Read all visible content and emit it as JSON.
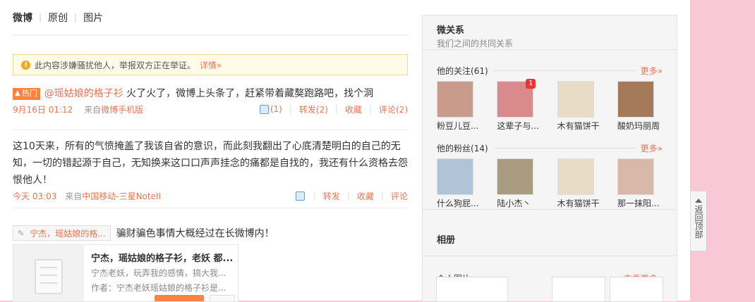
{
  "tabs": [
    "微博",
    "原创",
    "图片"
  ],
  "warning": {
    "text": "此内容涉嫌骚扰他人，举报双方正在举证。",
    "link": "详情»"
  },
  "post1": {
    "badge": "热门",
    "mention": "@瑶姑娘的格子衫",
    "text": " 火了火了，微博上头条了，赶紧带着藏獒跑路吧，找个洞",
    "time": "9月16日 01:12",
    "source_prefix": "来自",
    "source": "微博手机版",
    "like": "(1)",
    "forward": "转发(2)",
    "favorite": "收藏",
    "comment": "评论(2)"
  },
  "post2": {
    "text": "这10天来，所有的气愤掩盖了我该自省的意识，而此刻我翻出了心底清楚明白的自己的无知，一切的错起源于自己，无知换来这口口声声挂念的痛都是自找的，我还有什么资格去怨恨他人！",
    "time": "今天 03:03",
    "source_prefix": "来自",
    "source": "中国移动-三星NoteII",
    "forward": "转发",
    "favorite": "收藏",
    "comment": "评论"
  },
  "post3": {
    "chip": "宁杰，瑶姑娘的格...",
    "text": "骗财骗色事情大概经过在长微博内！",
    "card_title": "宁杰，瑶姑娘的格子衫，老妖 都...",
    "card_desc": "宁杰老妖，玩弄我的感情，搞大我...",
    "card_author": "作者：宁杰老妖瑶姑娘的格子衫是..."
  },
  "sidebar": {
    "title": "微关系",
    "subtitle": "我们之间的共同关系",
    "following_label": "他的关注",
    "following_count": "(61)",
    "more": "更多»",
    "following": [
      {
        "name": "粉豆儿豆...",
        "color": "#c89b8a"
      },
      {
        "name": "这辈子与...",
        "color": "#d98a8a",
        "badge": "1"
      },
      {
        "name": "木有猫饼干",
        "color": "#e9dcc7"
      },
      {
        "name": "酸奶玛丽周",
        "color": "#a57a5a"
      }
    ],
    "fans_label": "他的粉丝",
    "fans_count": "(14)",
    "fans": [
      {
        "name": "什么狗屁...",
        "color": "#b0c4d8"
      },
      {
        "name": "陆小杰丶",
        "color": "#a89b80"
      },
      {
        "name": "木有猫饼干",
        "color": "#e9dcc7"
      },
      {
        "name": "那一抹阳...",
        "color": "#d8b8a8"
      }
    ],
    "album_title": "相册",
    "photos_label": "个人图片",
    "photos_more": "查看更多»"
  },
  "backtop": {
    "label": "返回顶部"
  }
}
